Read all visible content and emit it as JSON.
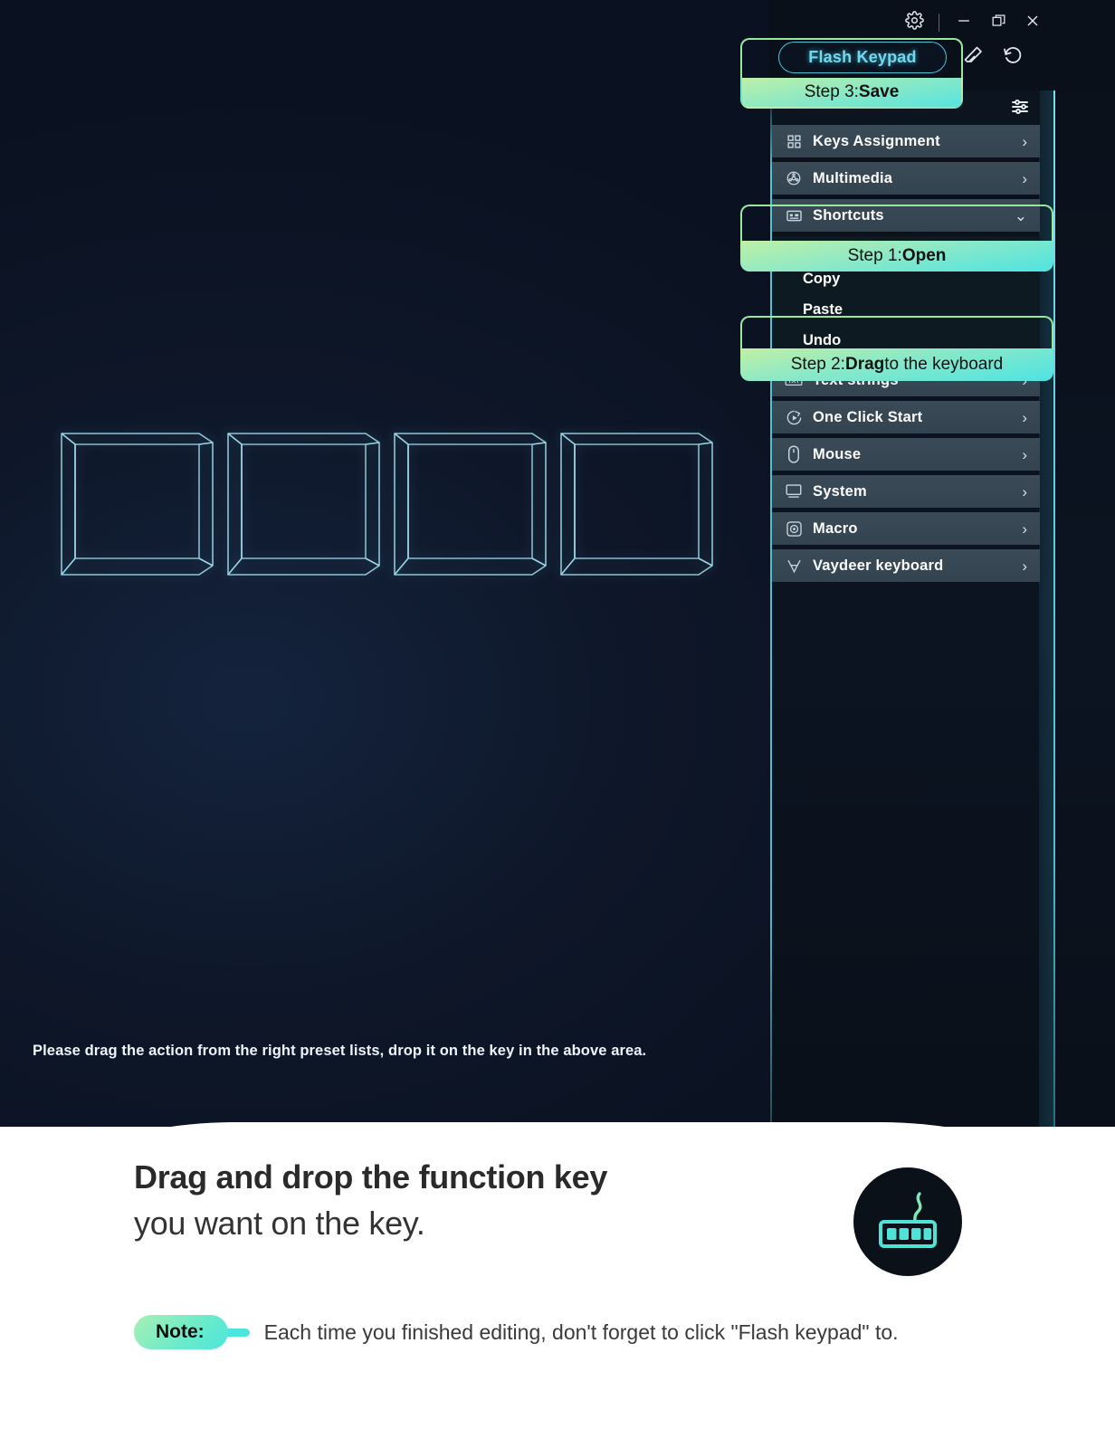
{
  "window": {
    "controls": [
      {
        "name": "settings",
        "glyph": "gear-icon"
      },
      {
        "name": "minimize",
        "glyph": "minimize-icon"
      },
      {
        "name": "restore",
        "glyph": "restore-icon"
      },
      {
        "name": "close",
        "glyph": "close-icon"
      }
    ]
  },
  "toolbar": {
    "flash_keypad_label": "Flash Keypad",
    "eraser_icon": "eraser-icon",
    "reset_icon": "reset-history-icon",
    "sliders_icon": "sliders-icon"
  },
  "menu": {
    "items": [
      {
        "label": "Keys Assignment",
        "icon": "grid-icon",
        "arrow": "›"
      },
      {
        "label": "Multimedia",
        "icon": "film-reel-icon",
        "arrow": "›"
      },
      {
        "label": "Shortcuts",
        "icon": "shortcuts-icon",
        "arrow": "⌄",
        "expanded": true
      },
      {
        "label": "Text strings",
        "icon": "text-icon",
        "arrow": "›"
      },
      {
        "label": "One Click Start",
        "icon": "one-click-icon",
        "arrow": "›"
      },
      {
        "label": "Mouse",
        "icon": "mouse-icon",
        "arrow": "›"
      },
      {
        "label": "System",
        "icon": "monitor-icon",
        "arrow": "›"
      },
      {
        "label": "Macro",
        "icon": "macro-icon",
        "arrow": "›"
      },
      {
        "label": "Vaydeer keyboard",
        "icon": "vaydeer-icon",
        "arrow": "›"
      }
    ],
    "shortcuts_sub": [
      {
        "label": "Copy"
      },
      {
        "label": "Paste"
      },
      {
        "label": "Undo"
      }
    ]
  },
  "keys": {
    "count": 4,
    "hint": "Please drag the action from the right preset lists, drop it on the key in the above area."
  },
  "callouts": [
    {
      "id": "step3",
      "prefix": "Step 3: ",
      "emphasis": "Save"
    },
    {
      "id": "step1",
      "prefix": "Step 1: ",
      "emphasis": "Open"
    },
    {
      "id": "step2",
      "prefix": "Step 2: ",
      "emphasis": "Drag",
      "suffix": "  to the keyboard"
    }
  ],
  "sheet": {
    "headline_line1": "Drag and drop the function key",
    "headline_line2": "you want on the key.",
    "badge_icon": "keypad-icon",
    "note_label": "Note:",
    "note_text": "Each time you finished editing, don't forget to click \"Flash keypad\" to."
  },
  "colors": {
    "accent_cyan": "#4ee3e2",
    "accent_green": "#9ae8a0",
    "pill_cyan": "#6fd9ee",
    "panel_item": "#3a4a56",
    "background_navy": "#0e1729"
  }
}
